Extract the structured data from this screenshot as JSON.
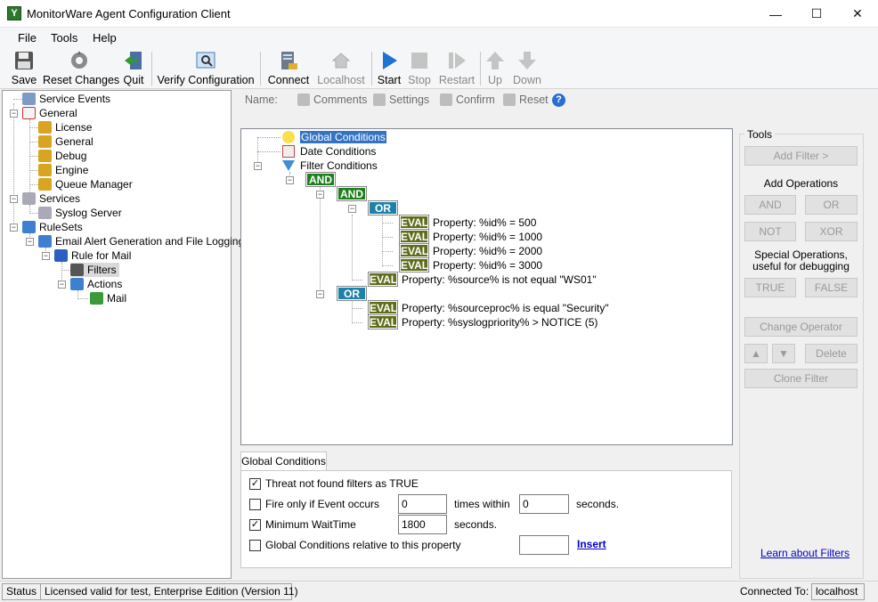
{
  "window": {
    "title": "MonitorWare Agent Configuration Client",
    "controls": [
      "—",
      "☐",
      "✕"
    ]
  },
  "menu": [
    "File",
    "Tools",
    "Help"
  ],
  "toolbar": [
    {
      "label": "Save",
      "icon": "floppy-disk-icon",
      "enabled": true
    },
    {
      "label": "Reset Changes",
      "icon": "reset-gear-icon",
      "enabled": true
    },
    {
      "label": "Quit",
      "icon": "quit-door-icon",
      "enabled": true
    },
    {
      "label": "Verify Configuration",
      "icon": "verify-magnifier-icon",
      "enabled": true
    },
    {
      "label": "Connect",
      "icon": "connect-server-icon",
      "enabled": true
    },
    {
      "label": "Localhost",
      "icon": "home-icon",
      "enabled": false
    },
    {
      "label": "Start",
      "icon": "play-icon",
      "enabled": true
    },
    {
      "label": "Stop",
      "icon": "stop-icon",
      "enabled": false
    },
    {
      "label": "Restart",
      "icon": "restart-icon",
      "enabled": false
    },
    {
      "label": "Up",
      "icon": "arrow-up-icon",
      "enabled": false
    },
    {
      "label": "Down",
      "icon": "arrow-down-icon",
      "enabled": false
    }
  ],
  "tree": [
    {
      "label": "Service Events",
      "icon": "service-events-icon"
    },
    {
      "label": "General",
      "icon": "general-checklist-icon"
    },
    {
      "label": "License",
      "icon": "license-gear-icon"
    },
    {
      "label": "General",
      "icon": "general-gear-icon"
    },
    {
      "label": "Debug",
      "icon": "debug-gear-icon"
    },
    {
      "label": "Engine",
      "icon": "engine-gear-icon"
    },
    {
      "label": "Queue Manager",
      "icon": "queue-gear-icon"
    },
    {
      "label": "Services",
      "icon": "services-gears-icon"
    },
    {
      "label": "Syslog Server",
      "icon": "syslog-gear-icon"
    },
    {
      "label": "RuleSets",
      "icon": "rulesets-icon"
    },
    {
      "label": "Email Alert Generation and File Logging",
      "icon": "ruleset-icon"
    },
    {
      "label": "Rule for Mail",
      "icon": "rule-cube-icon"
    },
    {
      "label": "Filters",
      "icon": "filter-funnel-icon"
    },
    {
      "label": "Actions",
      "icon": "actions-icon"
    },
    {
      "label": "Mail",
      "icon": "mail-action-icon"
    }
  ],
  "subbar": {
    "name_label": "Name:",
    "comments": "Comments",
    "settings": "Settings",
    "confirm": "Confirm",
    "reset": "Reset",
    "help": "?"
  },
  "filter_tree": {
    "global": "Global Conditions",
    "date": "Date Conditions",
    "filter": "Filter Conditions",
    "and1": "AND",
    "and2": "AND",
    "or1": "OR",
    "or2": "OR",
    "eval_label": "EVAL",
    "evals": [
      "Property: %id% = 500",
      "Property: %id% = 1000",
      "Property: %id% = 2000",
      "Property: %id% = 3000",
      "Property: %source% is not equal \"WS01\"",
      "Property: %sourceproc% is equal \"Security\"",
      "Property: %syslogpriority% >  NOTICE (5)"
    ]
  },
  "tools": {
    "title": "Tools",
    "add_filter": "Add Filter >",
    "add_operations": "Add Operations",
    "and": "AND",
    "or": "OR",
    "not": "NOT",
    "xor": "XOR",
    "special1": "Special Operations,",
    "special2": "useful for debugging",
    "true": "TRUE",
    "false": "FALSE",
    "change_operator": "Change Operator",
    "delete": "Delete",
    "clone_filter": "Clone Filter",
    "learn": "Learn about Filters"
  },
  "global_conditions": {
    "tab": "Global Conditions",
    "threat_label": "Threat not found filters as TRUE",
    "threat_checked": true,
    "fire_label": "Fire only if Event occurs",
    "fire_checked": false,
    "fire_count": "0",
    "times_within": "times within",
    "fire_seconds": "0",
    "seconds1": "seconds.",
    "min_wait_label": "Minimum WaitTime",
    "min_wait_checked": true,
    "min_wait_value": "1800",
    "seconds2": "seconds.",
    "relative_label": "Global Conditions relative to this property",
    "relative_checked": false,
    "relative_value": "",
    "insert": "Insert"
  },
  "status": {
    "label": "Status",
    "license": "Licensed valid for test, Enterprise Edition (Version 11)",
    "connected_label": "Connected To:",
    "connected_value": "localhost"
  },
  "colors": {
    "and_op": "#1e7f1e",
    "or_op": "#1e82a8",
    "eval_op": "#5e6d1a",
    "selected": "#d9d9d9",
    "link": "#0000cc"
  }
}
